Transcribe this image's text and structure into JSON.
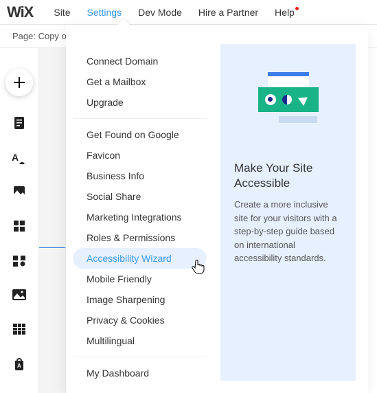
{
  "logo": "WiX",
  "topMenu": {
    "site": "Site",
    "settings": "Settings",
    "devMode": "Dev Mode",
    "hirePartner": "Hire a Partner",
    "help": "Help"
  },
  "subBar": {
    "pageLabel": "Page: Copy o"
  },
  "settingsMenu": {
    "group1": {
      "connectDomain": "Connect Domain",
      "getMailbox": "Get a Mailbox",
      "upgrade": "Upgrade"
    },
    "group2": {
      "getFound": "Get Found on Google",
      "favicon": "Favicon",
      "businessInfo": "Business Info",
      "socialShare": "Social Share",
      "marketingIntegrations": "Marketing Integrations",
      "rolesPermissions": "Roles & Permissions",
      "accessibilityWizard": "Accessibility Wizard",
      "mobileFriendly": "Mobile Friendly",
      "imageSharpening": "Image Sharpening",
      "privacyCookies": "Privacy & Cookies",
      "multilingual": "Multilingual"
    },
    "group3": {
      "myDashboard": "My Dashboard"
    }
  },
  "infoPanel": {
    "title": "Make Your Site Accessible",
    "desc": "Create a more inclusive site for your visitors with a step-by-step guide based on international accessibility standards."
  }
}
